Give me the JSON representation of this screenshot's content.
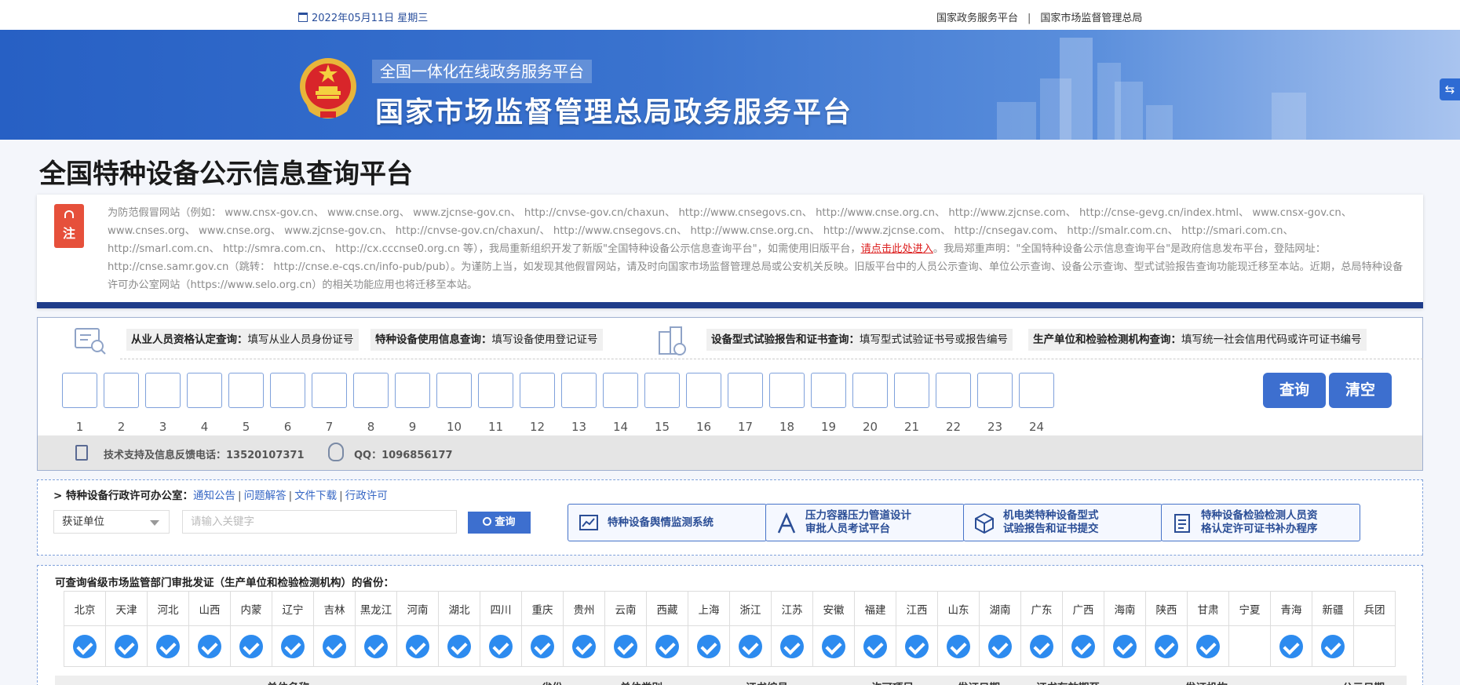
{
  "topbar": {
    "date": "2022年05月11日 星期三",
    "link1": "国家政务服务平台",
    "separator": "|",
    "link2": "国家市场监督管理总局"
  },
  "banner": {
    "subtitle": "全国一体化在线政务服务平台",
    "title": "国家市场监督管理总局政务服务平台"
  },
  "page_title": "全国特种设备公示信息查询平台",
  "notice": {
    "tag": "注",
    "text_before": "为防范假冒网站（例如： www.cnsx-gov.cn、 www.cnse.org、 www.zjcnse-gov.cn、 http://cnvse-gov.cn/chaxun、 http://www.cnsegovs.cn、 http://www.cnse.org.cn、 http://www.zjcnse.com、 http://cnse-gevg.cn/index.html、 www.cnsx-gov.cn、 www.cnses.org、 www.cnse.org、 www.zjcnse-gov.cn、 http://cnvse-gov.cn/chaxun/、 http://www.cnsegovs.cn、 http://www.cnse.org.cn、 http://www.zjcnse.com、 http://cnsegav.com、 http://smalr.com.cn、 http://smari.com.cn、 http://smarl.com.cn、 http://smra.com.cn、 http://cx.cccnse0.org.cn 等），我局重新组织开发了新版\"全国特种设备公示信息查询平台\"，如需使用旧版平台，",
    "link": "请点击此处进入",
    "text_after": "。我局郑重声明：\"全国特种设备公示信息查询平台\"是政府信息发布平台，登陆网址：http://cnse.samr.gov.cn（跳转： http://cnse.e-cqs.cn/info-pub/pub）。为谨防上当，如发现其他假冒网站，请及时向国家市场监督管理总局或公安机关反映。旧版平台中的人员公示查询、单位公示查询、设备公示查询、型式试验报告查询功能现迁移至本站。近期，总局特种设备许可办公室网站（https://www.selo.org.cn）的相关功能应用也将迁移至本站。"
  },
  "query": {
    "items": [
      {
        "bold": "从业人员资格认定查询：",
        "hint": "填写从业人员身份证号"
      },
      {
        "bold": "特种设备使用信息查询：",
        "hint": "填写设备使用登记证号"
      },
      {
        "bold": "设备型式试验报告和证书查询：",
        "hint": "填写型式试验证书号或报告编号"
      },
      {
        "bold": "生产单位和检验检测机构查询：",
        "hint": "填写统一社会信用代码或许可证书编号"
      }
    ],
    "digit_labels": [
      "1",
      "2",
      "3",
      "4",
      "5",
      "6",
      "7",
      "8",
      "9",
      "10",
      "11",
      "12",
      "13",
      "14",
      "15",
      "16",
      "17",
      "18",
      "19",
      "20",
      "21",
      "22",
      "23",
      "24"
    ],
    "query_button": "查询",
    "clear_button": "清空",
    "support_phone": "技术支持及信息反馈电话：13520107371",
    "support_qq": "QQ：1096856177"
  },
  "office": {
    "title": "> 特种设备行政许可办公室：",
    "links": [
      "通知公告",
      "问题解答",
      "文件下载",
      "行政许可"
    ],
    "link_sep": "|",
    "select_value": "获证单位",
    "search_placeholder": "请输入关键字",
    "search_button": "查询",
    "systems": [
      {
        "line1": "特种设备舆情监测系统",
        "line2": ""
      },
      {
        "line1": "压力容器压力管道设计",
        "line2": "审批人员考试平台"
      },
      {
        "line1": "机电类特种设备型式",
        "line2": "试验报告和证书提交"
      },
      {
        "line1": "特种设备检验检测人员资",
        "line2": "格认定许可证书补办程序"
      }
    ]
  },
  "provinces": {
    "title": "可查询省级市场监管部门审批发证（生产单位和检验检测机构）的省份：",
    "names": [
      "北京",
      "天津",
      "河北",
      "山西",
      "内蒙",
      "辽宁",
      "吉林",
      "黑龙江",
      "河南",
      "湖北",
      "四川",
      "重庆",
      "贵州",
      "云南",
      "西藏",
      "上海",
      "浙江",
      "江苏",
      "安徽",
      "福建",
      "江西",
      "山东",
      "湖南",
      "广东",
      "广西",
      "海南",
      "陕西",
      "甘肃",
      "宁夏",
      "青海",
      "新疆",
      "兵团"
    ],
    "checked": [
      true,
      true,
      true,
      true,
      true,
      true,
      true,
      true,
      true,
      true,
      true,
      true,
      true,
      true,
      true,
      true,
      true,
      true,
      true,
      true,
      true,
      true,
      true,
      true,
      true,
      true,
      true,
      true,
      false,
      true,
      true,
      false
    ],
    "table_headers": [
      "单位名称",
      "省份",
      "单位类别",
      "证书编号",
      "许可项目",
      "发证日期",
      "证书有效期至",
      "发证机构",
      "公示日期"
    ]
  },
  "colors": {
    "brand_blue": "#3d6fcf",
    "banner_blue": "#2760c4",
    "notice_red": "#e6503b",
    "check_blue": "#2d8bef"
  }
}
